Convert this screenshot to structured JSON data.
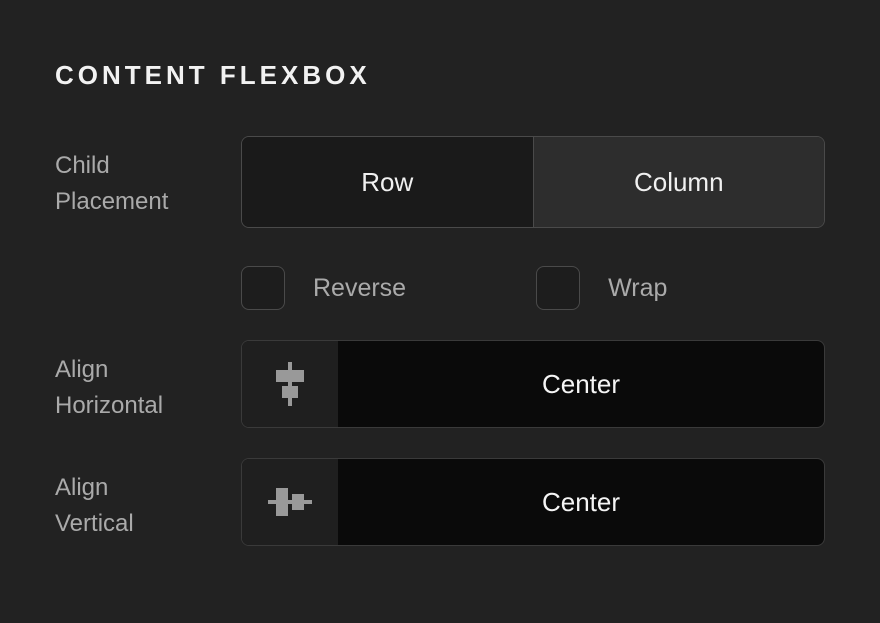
{
  "section": {
    "title": "CONTENT FLEXBOX"
  },
  "childPlacement": {
    "label": "Child\nPlacement",
    "options": {
      "row": "Row",
      "column": "Column"
    },
    "selected": "column"
  },
  "checkboxes": {
    "reverse": {
      "label": "Reverse",
      "checked": false
    },
    "wrap": {
      "label": "Wrap",
      "checked": false
    }
  },
  "alignHorizontal": {
    "label": "Align\nHorizontal",
    "value": "Center"
  },
  "alignVertical": {
    "label": "Align\nVertical",
    "value": "Center"
  }
}
